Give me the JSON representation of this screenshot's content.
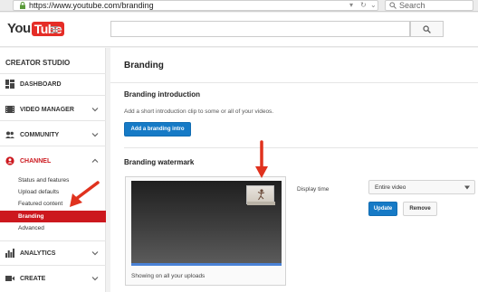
{
  "browser": {
    "url": "https://www.youtube.com/branding",
    "search_placeholder": "Search"
  },
  "header": {
    "logo_you": "You",
    "logo_tube": "Tube"
  },
  "sidebar": {
    "studio_title": "CREATOR STUDIO",
    "items": [
      {
        "label": "DASHBOARD",
        "icon": "dashboard-icon"
      },
      {
        "label": "VIDEO MANAGER",
        "icon": "video-manager-icon"
      },
      {
        "label": "COMMUNITY",
        "icon": "community-icon"
      },
      {
        "label": "CHANNEL",
        "icon": "channel-icon"
      },
      {
        "label": "ANALYTICS",
        "icon": "analytics-icon"
      },
      {
        "label": "CREATE",
        "icon": "create-icon"
      }
    ],
    "channel_subitems": [
      "Status and features",
      "Upload defaults",
      "Featured content",
      "Branding",
      "Advanced"
    ]
  },
  "main": {
    "page_title": "Branding",
    "intro": {
      "title": "Branding introduction",
      "description": "Add a short introduction clip to some or all of your videos.",
      "button_label": "Add a branding intro"
    },
    "watermark": {
      "title": "Branding watermark",
      "caption": "Showing on all your uploads",
      "display_time_label": "Display time",
      "display_time_value": "Entire video",
      "update_label": "Update",
      "remove_label": "Remove"
    }
  },
  "colors": {
    "accent_red": "#cc181e",
    "button_blue": "#167ac6",
    "annotation_red": "#e0321e"
  }
}
